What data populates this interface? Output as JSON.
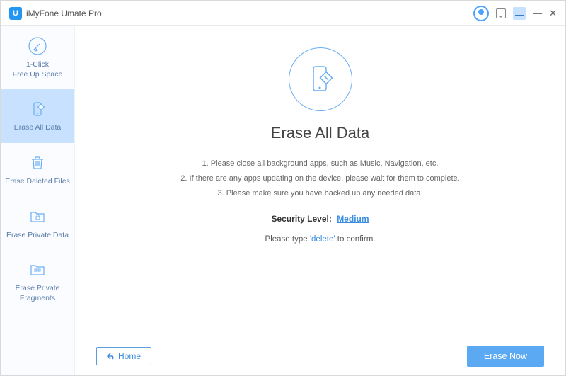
{
  "app_title": "iMyFone Umate Pro",
  "logo_letter": "U",
  "sidebar": {
    "items": [
      {
        "label": "1-Click\nFree Up Space"
      },
      {
        "label": "Erase All Data"
      },
      {
        "label": "Erase Deleted Files"
      },
      {
        "label": "Erase Private Data"
      },
      {
        "label": "Erase Private\nFragments"
      }
    ]
  },
  "main": {
    "heading": "Erase All Data",
    "instructions": [
      "1. Please close all background apps, such as Music, Navigation, etc.",
      "2. If there are any apps updating on the device, please wait for them to complete.",
      "3. Please make sure you have backed up any needed data."
    ],
    "security_label": "Security Level:",
    "security_value": "Medium",
    "confirm_prefix": "Please type",
    "confirm_keyword": "'delete'",
    "confirm_suffix": "to confirm.",
    "confirm_value": ""
  },
  "footer": {
    "home": "Home",
    "erase": "Erase Now"
  }
}
